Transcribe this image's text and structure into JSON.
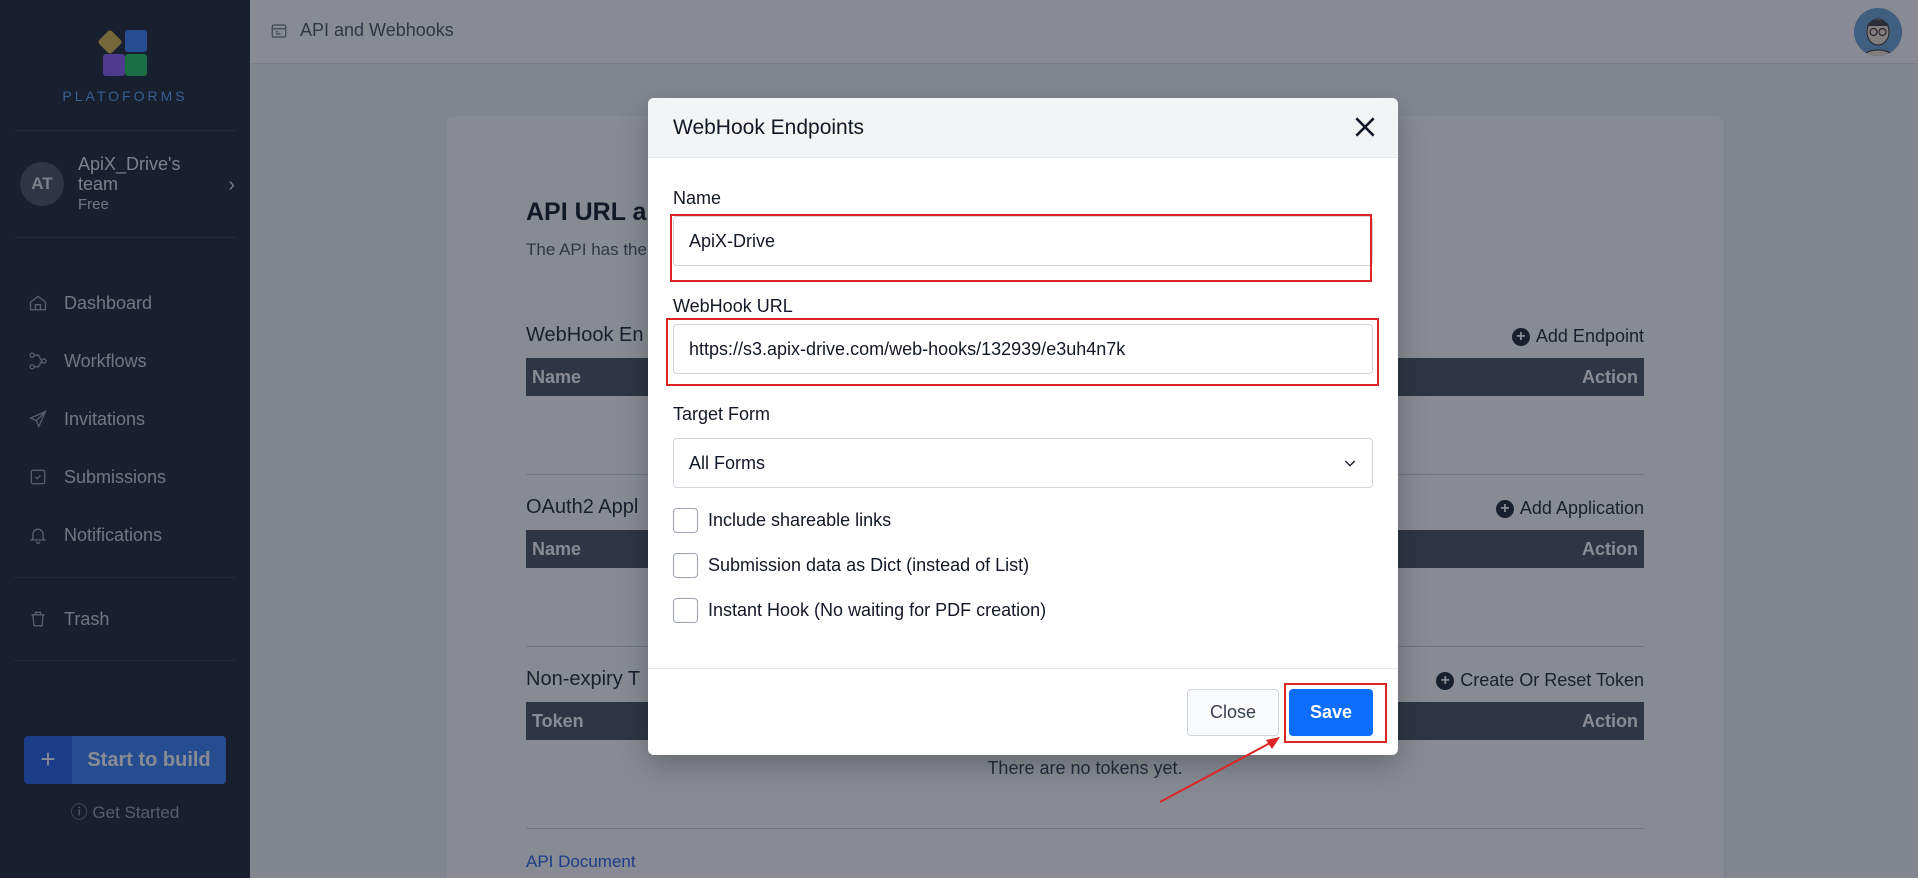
{
  "app": {
    "brand": "PLATOFORMS",
    "page_title": "API and Webhooks"
  },
  "sidebar": {
    "team": {
      "initials": "AT",
      "name": "ApiX_Drive's team",
      "plan": "Free"
    },
    "items": [
      {
        "label": "Dashboard",
        "icon": "home-icon"
      },
      {
        "label": "Workflows",
        "icon": "workflow-icon"
      },
      {
        "label": "Invitations",
        "icon": "send-icon"
      },
      {
        "label": "Submissions",
        "icon": "inbox-icon"
      },
      {
        "label": "Notifications",
        "icon": "bell-icon"
      },
      {
        "label": "Trash",
        "icon": "trash-icon"
      }
    ],
    "build_button": "Start to build",
    "get_started": "Get Started"
  },
  "main": {
    "heading": "API URL ar",
    "description": "The API has the",
    "sections": [
      {
        "title": "WebHook En",
        "action": "Add Endpoint",
        "col_left": "Name",
        "col_right": "Action"
      },
      {
        "title": "OAuth2 Appl",
        "action": "Add Application",
        "col_left": "Name",
        "col_right": "Action"
      },
      {
        "title": "Non-expiry T",
        "action": "Create Or Reset Token",
        "col_left": "Token",
        "col_right": "Action",
        "empty": "There are no tokens yet."
      }
    ],
    "api_document": "API Document"
  },
  "modal": {
    "title": "WebHook Endpoints",
    "name_label": "Name",
    "name_value": "ApiX-Drive",
    "url_label": "WebHook URL",
    "url_value": "https://s3.apix-drive.com/web-hooks/132939/e3uh4n7k",
    "target_label": "Target Form",
    "target_value": "All Forms",
    "checkboxes": [
      {
        "label": "Include shareable links",
        "checked": false
      },
      {
        "label": "Submission data as Dict (instead of List)",
        "checked": false
      },
      {
        "label": "Instant Hook (No waiting for PDF creation)",
        "checked": false
      }
    ],
    "close_label": "Close",
    "save_label": "Save"
  },
  "colors": {
    "sidebar_bg": "#1f2937",
    "primary": "#0d6efd",
    "annotation": "#dc2626"
  }
}
